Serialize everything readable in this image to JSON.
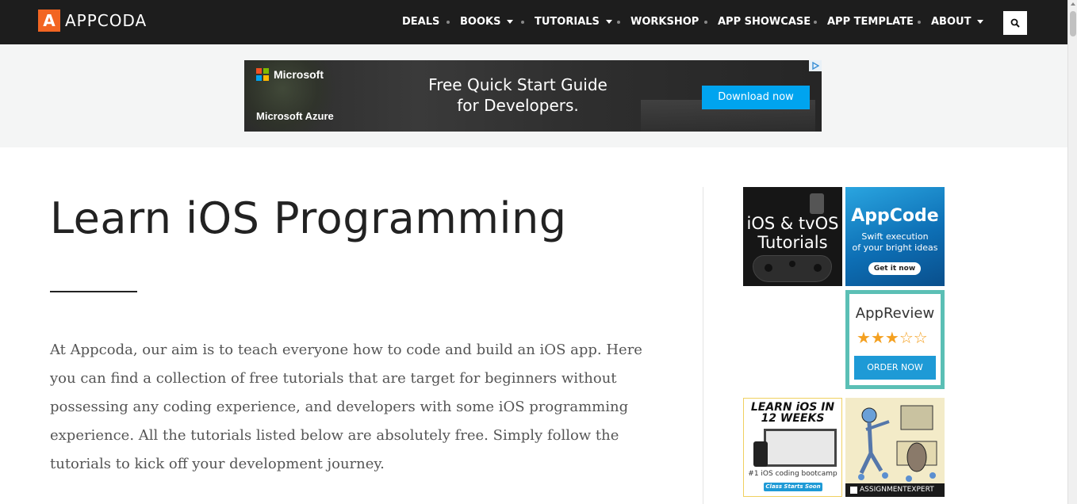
{
  "site": {
    "logo_mark": "A",
    "logo_text": "APPCODA"
  },
  "nav": {
    "items": [
      {
        "label": "DEALS",
        "has_dropdown": false
      },
      {
        "label": "BOOKS",
        "has_dropdown": true
      },
      {
        "label": "TUTORIALS",
        "has_dropdown": true
      },
      {
        "label": "WORKSHOP",
        "has_dropdown": false
      },
      {
        "label": "APP SHOWCASE",
        "has_dropdown": false
      },
      {
        "label": "APP TEMPLATE",
        "has_dropdown": false
      },
      {
        "label": "ABOUT",
        "has_dropdown": true
      }
    ],
    "search_icon": "search-icon"
  },
  "top_ad": {
    "brand": "Microsoft",
    "product": "Microsoft Azure",
    "headline_line1": "Free Quick Start Guide",
    "headline_line2": "for Developers.",
    "cta": "Download now"
  },
  "main": {
    "title": "Learn iOS Programming",
    "intro": "At Appcoda, our aim is to teach everyone how to code and build an iOS app. Here you can find a collection of free tutorials that are target for beginners without possessing any coding experience, and developers with some iOS programming experience. All the tutorials listed below are absolutely free. Simply follow the tutorials to kick off your development journey."
  },
  "sidebar_ads": {
    "ios_tvos": {
      "line1": "iOS & tvOS",
      "line2": "Tutorials"
    },
    "appcode": {
      "title": "AppCode",
      "line1": "Swift execution",
      "line2": "of your bright ideas",
      "cta": "Get it now"
    },
    "appreview": {
      "title": "AppReview",
      "rating": 3,
      "max_rating": 5,
      "cta": "ORDER NOW"
    },
    "learn_ios": {
      "line1": "LEARN iOS IN",
      "line2": "12 WEEKS",
      "sub": "#1 iOS coding bootcamp",
      "cta": "Class Starts Soon"
    },
    "assignment": {
      "label": "ASSIGNMENTEXPERT"
    }
  },
  "colors": {
    "nav_bg": "#1d1d1d",
    "brand_orange": "#f26522",
    "azure_blue": "#00a4ef",
    "review_teal": "#5bbfb5",
    "star_gold": "#f4a020"
  }
}
